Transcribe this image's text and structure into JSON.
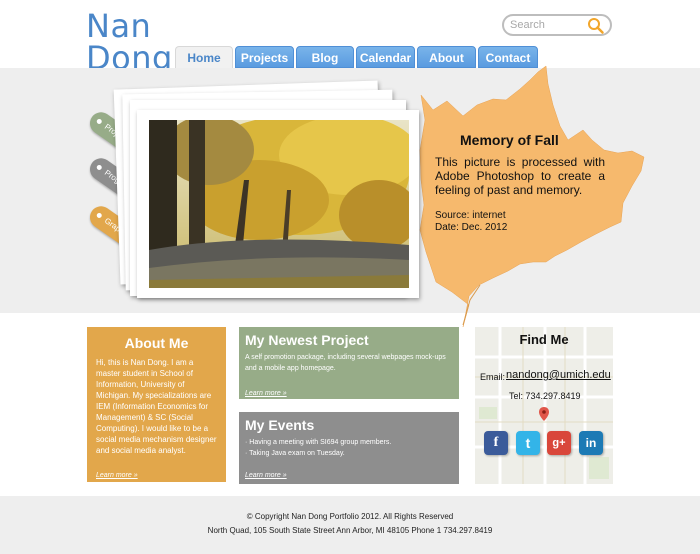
{
  "logo": {
    "line1": "Nan",
    "line2": "Dong"
  },
  "search": {
    "placeholder": "Search"
  },
  "nav": {
    "tabs": [
      {
        "label": "Home",
        "active": true
      },
      {
        "label": "Projects"
      },
      {
        "label": "Blog"
      },
      {
        "label": "Calendar"
      },
      {
        "label": "About"
      },
      {
        "label": "Contact"
      }
    ]
  },
  "side_tags": [
    {
      "label": "Projects",
      "color": "#97ac88"
    },
    {
      "label": "Programming",
      "color": "#8e8e8e"
    },
    {
      "label": "Graphic Design",
      "color": "#e2a74b"
    }
  ],
  "memory": {
    "title": "Memory of Fall",
    "text": "This picture is processed with Adobe Photoshop to create a feeling of past and memory.",
    "source": "Source: internet",
    "date": "Date:  Dec. 2012"
  },
  "about": {
    "title": "About Me",
    "text": "Hi, this is Nan Dong. I am a master student in School of Information, University of Michigan. My specializations are IEM (Information Economics for Management) & SC (Social Computing). I would like to be a social media mechanism designer and social media analyst.",
    "more": "Learn more »"
  },
  "newest": {
    "title": "My Newest Project",
    "text": "A self promotion package, including several webpages mock-ups and a mobile app homepage.",
    "more": "Learn more »"
  },
  "events": {
    "title": "My Events",
    "items": [
      "· Having a meeting with SI694 group members.",
      "· Taking Java exam on Tuesday."
    ],
    "more": "Learn more »"
  },
  "findme": {
    "title": "Find Me",
    "email_label": "Email:",
    "email": "nandong@umich.edu",
    "tel": "Tel: 734.297.8419",
    "social": [
      {
        "glyph": "f",
        "icon": "facebook-icon",
        "color": "#3b5b9a"
      },
      {
        "glyph": "t",
        "icon": "twitter-icon",
        "color": "#33b4e8"
      },
      {
        "glyph": "g+",
        "icon": "google-plus-icon",
        "color": "#d9473b"
      },
      {
        "glyph": "in",
        "icon": "linkedin-icon",
        "color": "#1c7ab5"
      }
    ]
  },
  "footer": {
    "copyright": "© Copyright   Nan Dong Portfolio 2012. All Rights Reserved",
    "address": "North Quad, 105 South State Street Ann Arbor, MI  48105 Phone 1 734.297.8419"
  },
  "colors": {
    "brand": "#4a86c8",
    "tab": "#5a9be0",
    "leaf": "#f6b96d",
    "about": "#e2a74b",
    "newest": "#97ac88",
    "events": "#8e8e8e"
  }
}
